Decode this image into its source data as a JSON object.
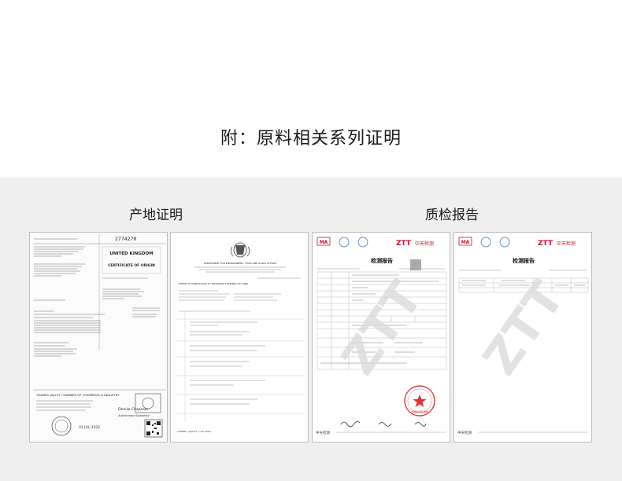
{
  "page": {
    "title": "附：原料相关系列证明"
  },
  "sections": {
    "origin": {
      "title": "产地证明"
    },
    "report": {
      "title": "质检报告"
    }
  },
  "doc1": {
    "cert_number": "2774270",
    "stamp_text": "UNITED KINGDOM",
    "stamp_sub": "CERTIFICATE OF ORIGIN",
    "footer_org": "THAMES VALLEY CHAMBER OF COMMERCE & INDUSTRY",
    "signature_name": "Denise Chapman",
    "signature_role": "Authorised Signatory",
    "date_stamp": "01 JUL 2022"
  },
  "doc2": {
    "header_line1": "DEPARTMENT FOR ENVIRONMENT, FOOD AND RURAL AFFAIRS",
    "header_line2": "EXPORT OF HONEYSUCKLE TO THE PEOPLE'S REPUBLIC OF CHINA",
    "footer_code": "ITXR000 (Update 7/16.2019)"
  },
  "doc3": {
    "brand": "ZTT",
    "brand_cn": "中天检测",
    "report_title": "检测报告",
    "watermark": "ZTT",
    "footer_left": "中天检测",
    "seal_text": "检验检测专用章"
  },
  "doc4": {
    "brand": "ZTT",
    "brand_cn": "中天检测",
    "report_title": "检测报告",
    "watermark": "ZTT",
    "footer_left": "中天检测"
  },
  "colors": {
    "accent_red": "#c8102e",
    "seal_red": "#d42020",
    "watermark_gray": "#d9d9d9",
    "panel_bg": "#efefef"
  }
}
